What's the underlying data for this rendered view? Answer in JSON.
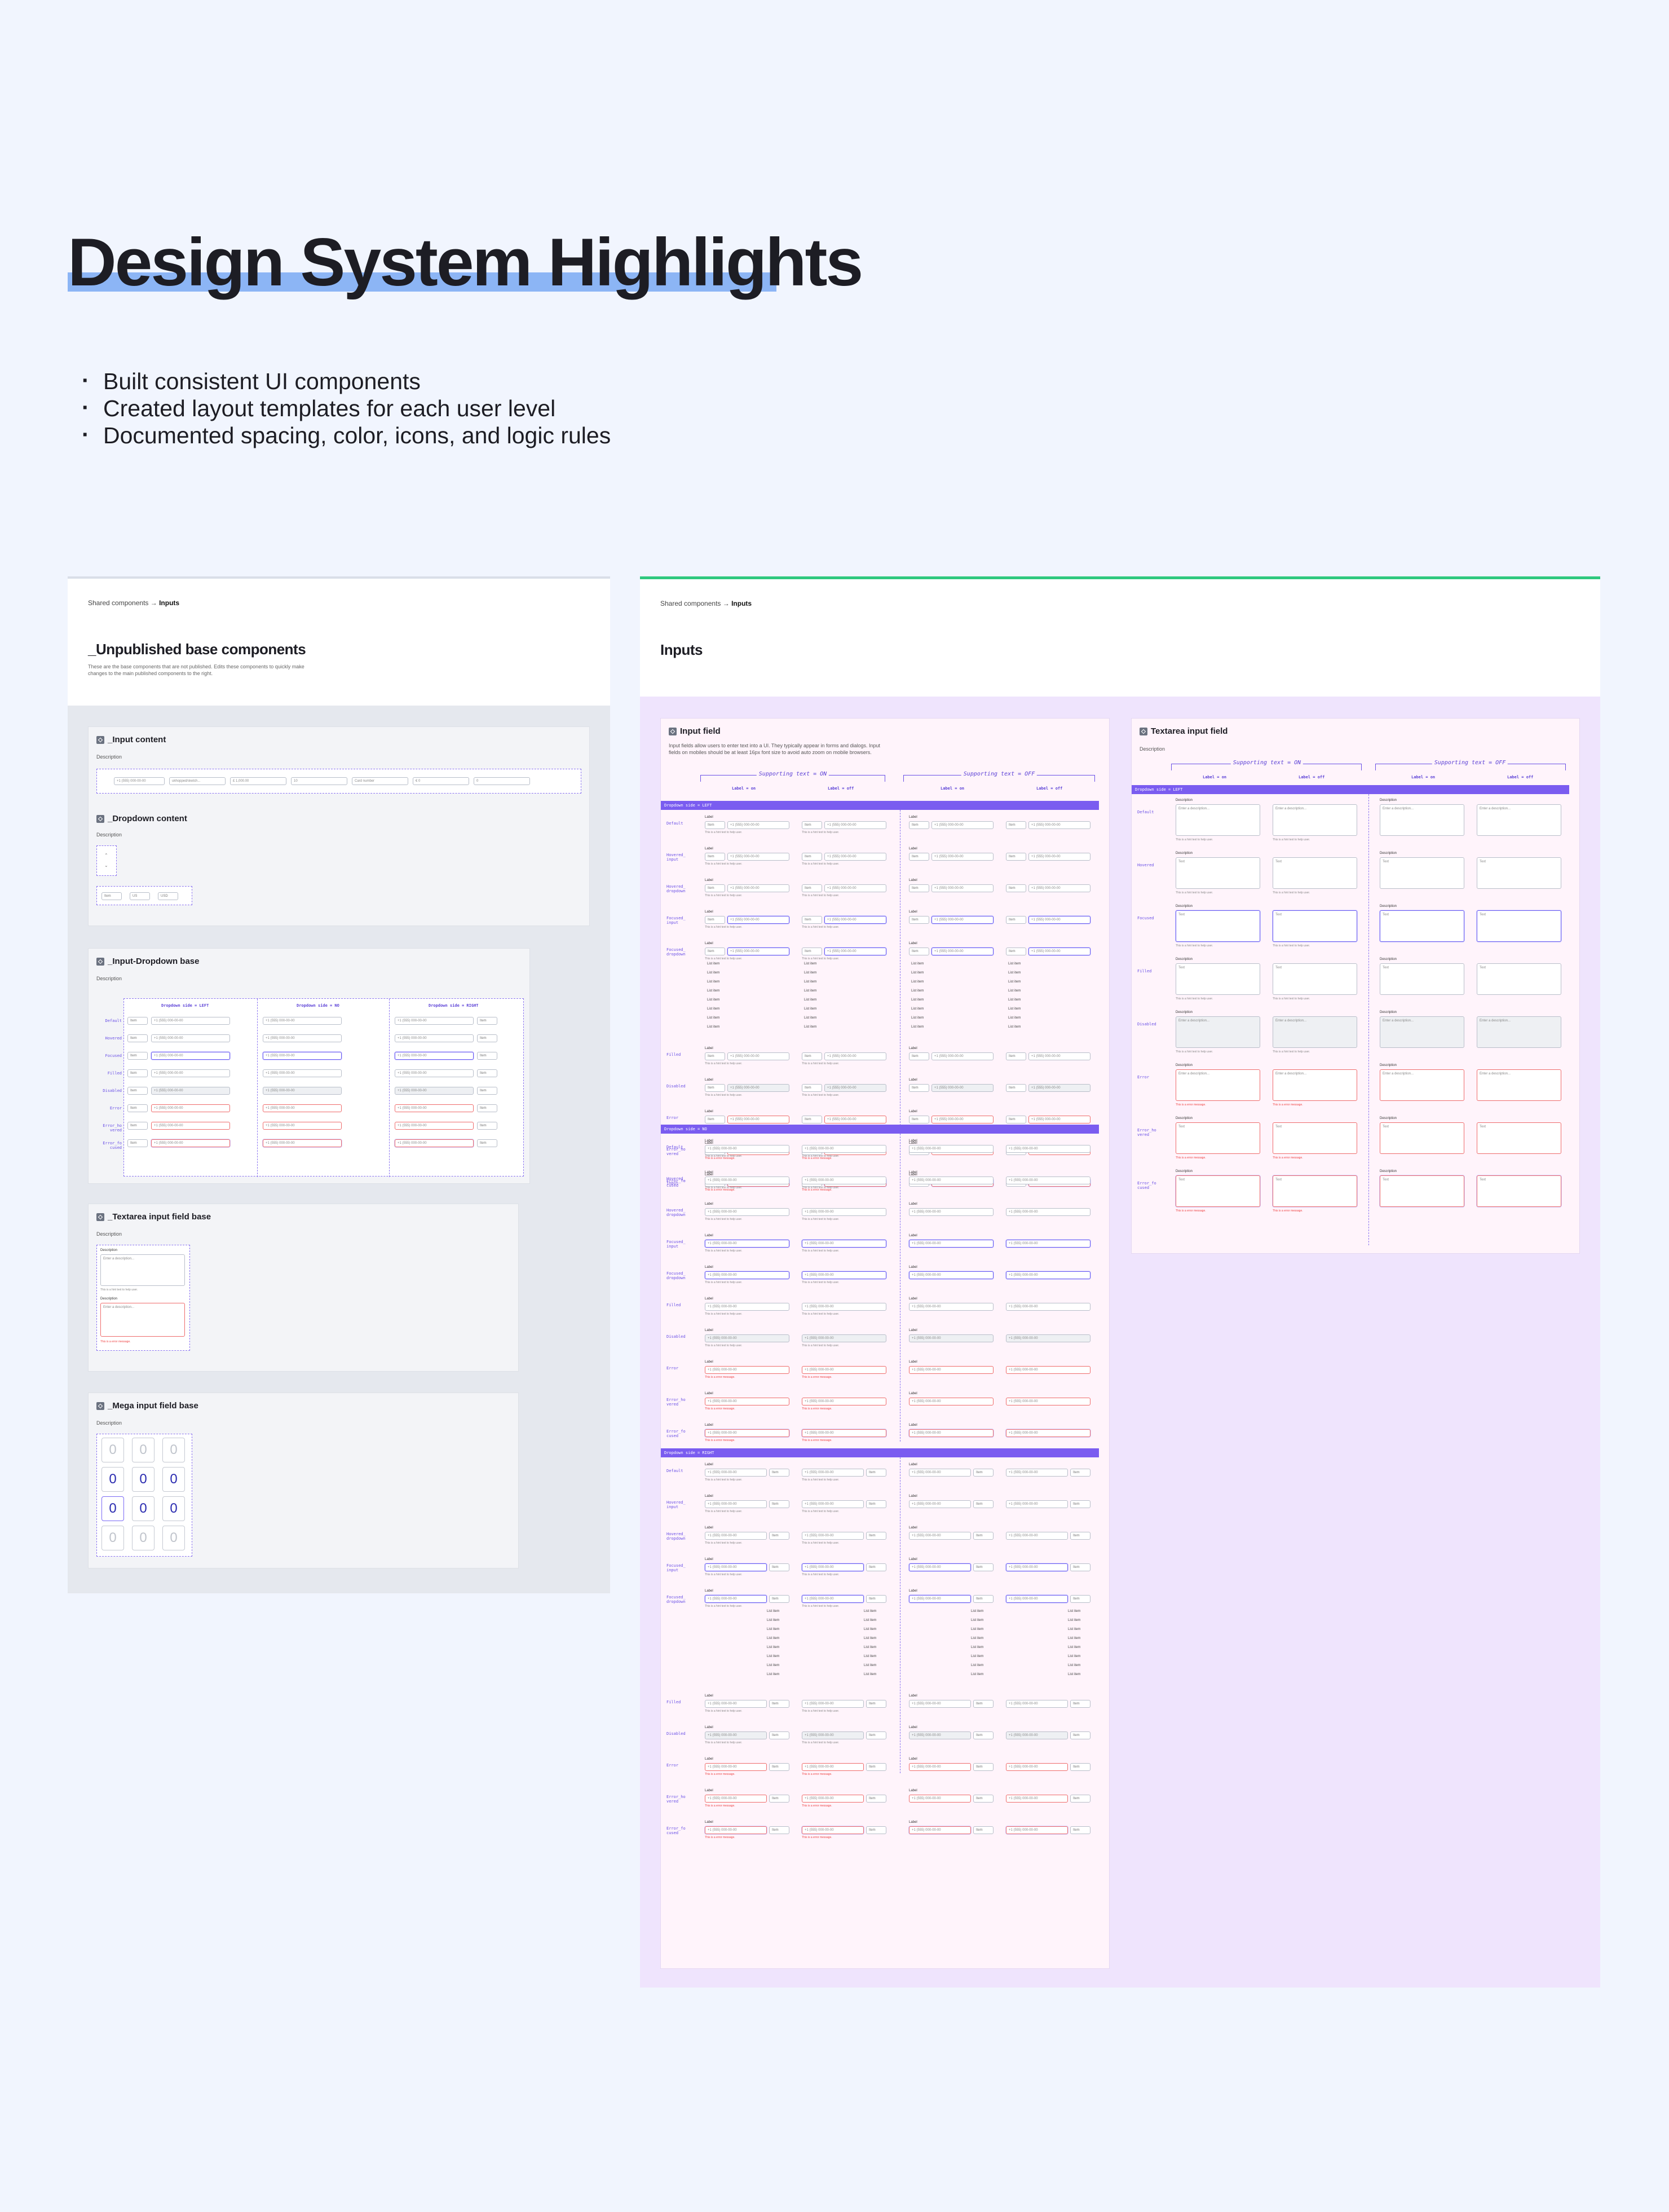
{
  "hero": {
    "title": "Design System Highlights",
    "bullets": [
      "Built consistent UI components",
      "Created layout templates for each user level",
      "Documented spacing, color, icons, and logic rules"
    ]
  },
  "left_frame": {
    "breadcrumb_parent": "Shared components →",
    "breadcrumb_current": "Inputs",
    "title": "_Unpublished base components",
    "description": "These are the base components that are not published. Edits these components to quickly make changes to the main published components to the right.",
    "cards": {
      "input_content": {
        "title": "_Input content",
        "desc": "Description",
        "chips": [
          "+1 (555) 000-00-00",
          "ukhopped/sketch...",
          "£ 1,000.00",
          "10",
          "EAN",
          "Card number",
          "€ 0",
          "1 0.00",
          "0"
        ]
      },
      "dropdown_content": {
        "title": "_Dropdown content",
        "desc": "Description",
        "selects": [
          "Item",
          "US",
          "USD"
        ]
      },
      "input_dropdown_base": {
        "title": "_Input-Dropdown base",
        "desc": "Description",
        "col_headers": [
          "Dropdown side = LEFT",
          "Dropdown side = NO",
          "Dropdown side = RIGHT"
        ],
        "rows": [
          "Default",
          "Hovered",
          "Focused",
          "Filled",
          "Disabled",
          "Error",
          "Error_ho vered",
          "Error_fo cused"
        ],
        "value": "+1 (555) 000-00-00",
        "select": "Item"
      },
      "textarea_base": {
        "title": "_Textarea input field base",
        "desc": "Description",
        "label": "Description",
        "placeholder": "Enter a description...",
        "help": "This is a hint text to help user.",
        "error": "This is a error message."
      },
      "mega_base": {
        "title": "_Mega input field base",
        "desc": "Description",
        "digit": "0"
      }
    }
  },
  "right_frame": {
    "breadcrumb_parent": "Shared components →",
    "breadcrumb_current": "Inputs",
    "title": "Inputs",
    "input_field": {
      "title": "Input field",
      "description": "Input fields allow users to enter text into a UI. They typically appear in forms and dialogs. Input fields on mobiles should be at least 16px font size to avoid auto zoom on mobile browsers.",
      "bracket_on": "Supporting text = ON",
      "bracket_off": "Supporting text = OFF",
      "label_on": "Label = on",
      "label_off": "Label = off",
      "sections": [
        "Dropdown side = LEFT",
        "Dropdown side = NO",
        "Dropdown side = RIGHT"
      ],
      "rows": [
        "Default",
        "Hovered_ input",
        "Hovered_ dropdown",
        "Focused_ input",
        "Focused_ dropdown",
        "Filled",
        "Disabled",
        "Error",
        "Error_ho vered",
        "Error_fo cused"
      ],
      "label": "Label",
      "value": "+1 (555) 000-00-00",
      "select": "Item",
      "help": "This is a hint text to help user.",
      "error": "This is a error message.",
      "list_item": "List item"
    },
    "textarea_field": {
      "title": "Textarea input field",
      "desc": "Description",
      "bracket_on": "Supporting text = ON",
      "bracket_off": "Supporting text = OFF",
      "label_on": "Label = on",
      "label_off": "Label = off",
      "section": "Dropdown side = LEFT",
      "rows": [
        "Default",
        "Hovered",
        "Focused",
        "Filled",
        "Disabled",
        "Error",
        "Error_ho vered",
        "Error_fo cused"
      ],
      "label": "Description",
      "placeholder": "Enter a description...",
      "value": "Text",
      "help": "This is a hint text to help user.",
      "error": "This is a error message."
    }
  }
}
